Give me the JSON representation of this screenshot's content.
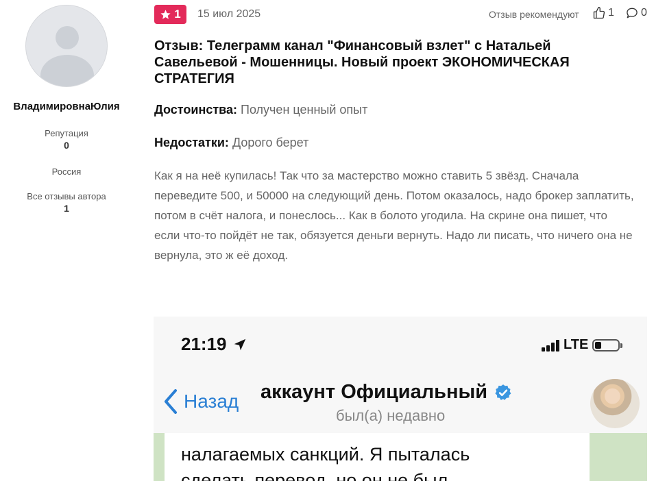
{
  "author": {
    "name": "ВладимировнаЮлия",
    "reputation_label": "Репутация",
    "reputation_value": "0",
    "country": "Россия",
    "all_reviews_label": "Все отзывы автора",
    "all_reviews_value": "1"
  },
  "review": {
    "rating": "1",
    "date": "15 июл 2025",
    "recommend_label": "Отзыв рекомендуют",
    "likes": "1",
    "comments": "0",
    "title": "Отзыв: Телеграмм канал \"Финансовый взлет\" с Натальей Савельевой - Мошенницы. Новый проект ЭКОНОМИЧЕСКАЯ СТРАТЕГИЯ",
    "pros_label": "Достоинства:",
    "pros_value": "Получен ценный опыт",
    "cons_label": "Недостатки:",
    "cons_value": "Дорого берет",
    "text": "Как я на неё купилась! Так что за мастерство можно ставить 5 звёзд. Сначала переведите 500, и 50000 на следующий день. Потом оказалось, надо брокер заплатить, потом в счёт налога, и понеслось... Как в болото угодила. На скрине она пишет, что если что-то пойдёт не так, обязуется деньги вернуть. Надо ли писать, что ничего она не вернула, это ж её доход."
  },
  "screenshot": {
    "time": "21:19",
    "network": "LTE",
    "back_label": "Назад",
    "chat_title": "аккаунт Официальный",
    "chat_status": "был(а) недавно",
    "message_line1": "налагаемых санкций. Я пыталась",
    "message_line2": "сделать перевод, но он не был"
  },
  "colors": {
    "badge": "#e32a5a",
    "telegram_blue": "#2a7fd4"
  },
  "icons": [
    "star-icon",
    "thumbs-up-icon",
    "comment-icon",
    "location-arrow-icon",
    "signal-icon",
    "battery-icon",
    "back-chevron-icon",
    "verified-icon"
  ]
}
